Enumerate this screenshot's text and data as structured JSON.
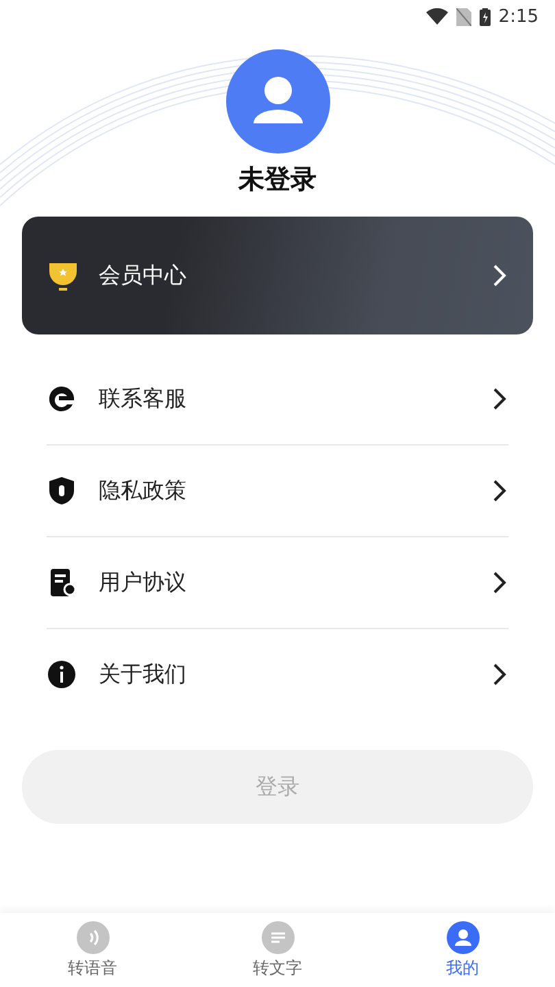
{
  "status_bar": {
    "time": "2:15"
  },
  "profile": {
    "name": "未登录"
  },
  "member_card": {
    "label": "会员中心"
  },
  "menu": [
    {
      "label": "联系客服"
    },
    {
      "label": "隐私政策"
    },
    {
      "label": "用户协议"
    },
    {
      "label": "关于我们"
    }
  ],
  "login_button": {
    "label": "登录",
    "disabled": true
  },
  "tabs": [
    {
      "label": "转语音",
      "selected": false
    },
    {
      "label": "转文字",
      "selected": false
    },
    {
      "label": "我的",
      "selected": true
    }
  ]
}
